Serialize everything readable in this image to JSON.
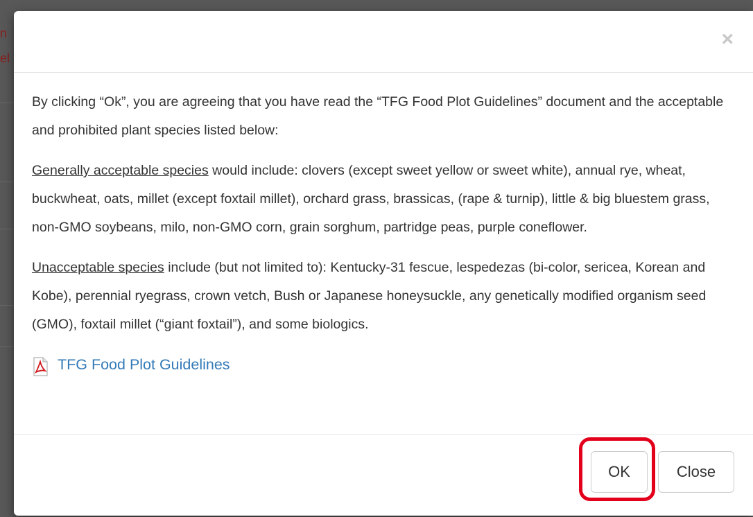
{
  "backdrop": {
    "line1": "n",
    "line2": "el"
  },
  "modal": {
    "close_symbol": "×",
    "paragraphs": {
      "intro": "By clicking “Ok”, you are agreeing that you have read the “TFG Food Plot Guidelines” document and the acceptable and prohibited plant species listed below:",
      "acceptable_label": "Generally acceptable species",
      "acceptable_text": " would include: clovers (except sweet yellow or sweet white), annual rye, wheat, buckwheat, oats, millet (except foxtail millet), orchard grass, brassicas, (rape & turnip), little & big bluestem grass, non-GMO soybeans, milo, non-GMO corn, grain sorghum, partridge peas, purple coneflower.",
      "unacceptable_label": "Unacceptable species",
      "unacceptable_text": " include (but not limited to): Kentucky-31 fescue, lespedezas (bi-color, sericea, Korean and Kobe), perennial ryegrass, crown vetch, Bush or Japanese honeysuckle, any genetically modified organism seed (GMO), foxtail millet (“giant foxtail”), and some biologics."
    },
    "pdf_link_text": "TFG Food Plot Guidelines",
    "pdf_icon": "pdf-icon",
    "buttons": {
      "ok_label": "OK",
      "close_label": "Close"
    },
    "colors": {
      "link": "#337ab7",
      "highlight": "#e3001b"
    }
  }
}
